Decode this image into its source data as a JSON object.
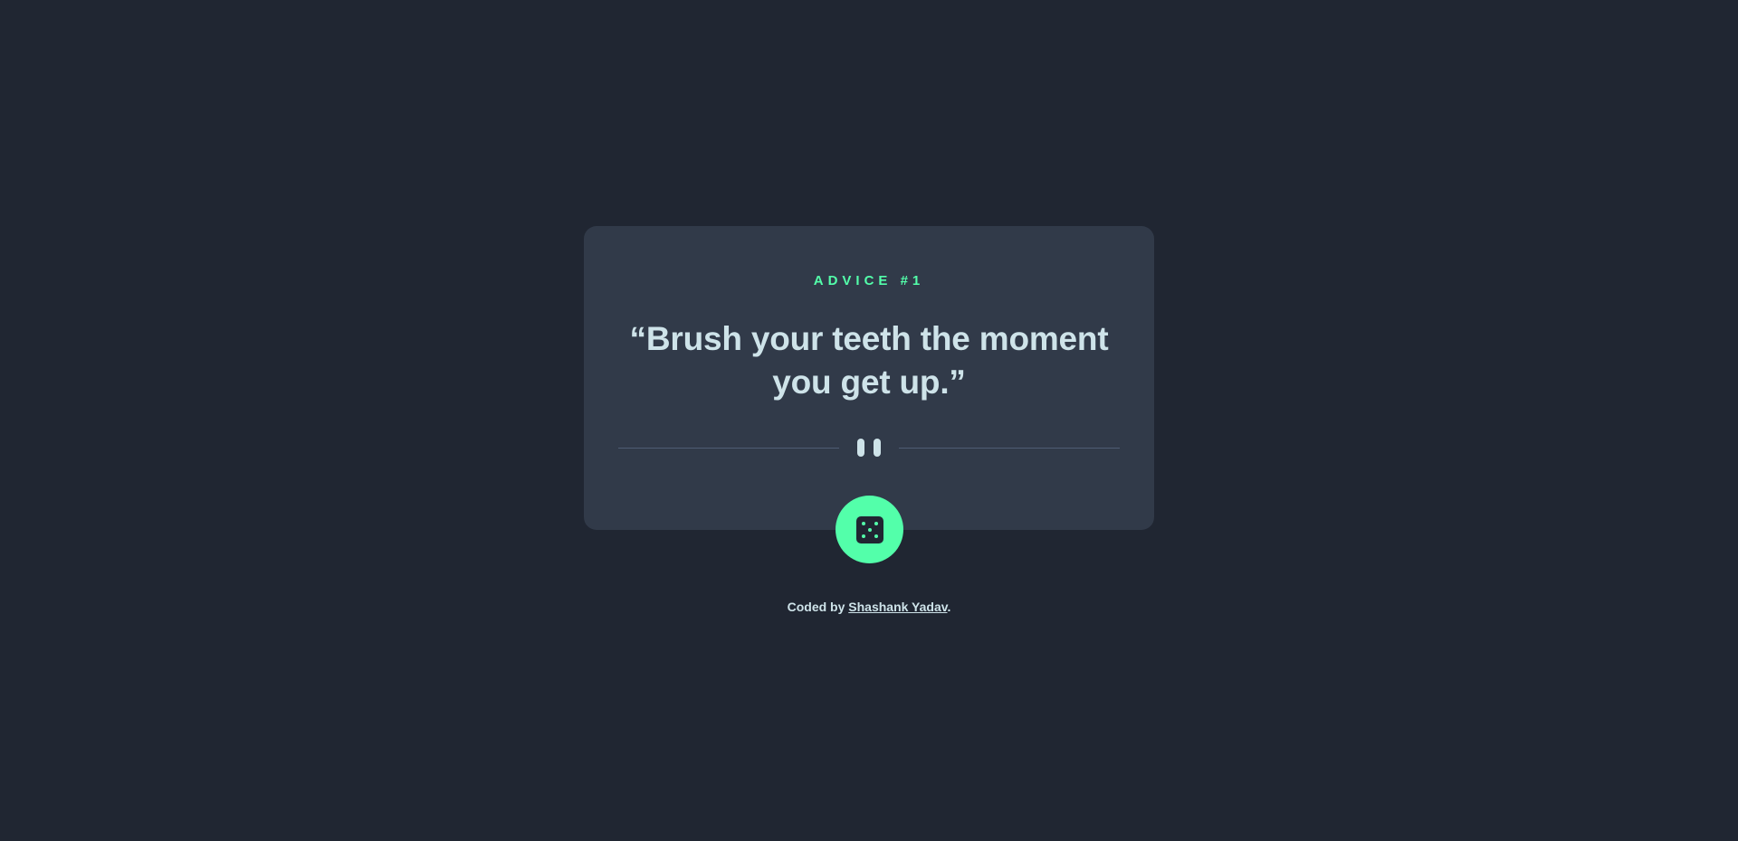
{
  "card": {
    "label": "ADVICE #1",
    "quote": "“Brush your teeth the moment you get up.”"
  },
  "icons": {
    "divider": "pause-icon",
    "button": "dice-icon"
  },
  "footer": {
    "prefix": "Coded by ",
    "author": "Shashank Yadav",
    "suffix": "."
  },
  "colors": {
    "background": "#202632",
    "card": "#313a49",
    "accent": "#53ffaa",
    "text": "#cee3e9",
    "divider": "#4f5d74"
  }
}
